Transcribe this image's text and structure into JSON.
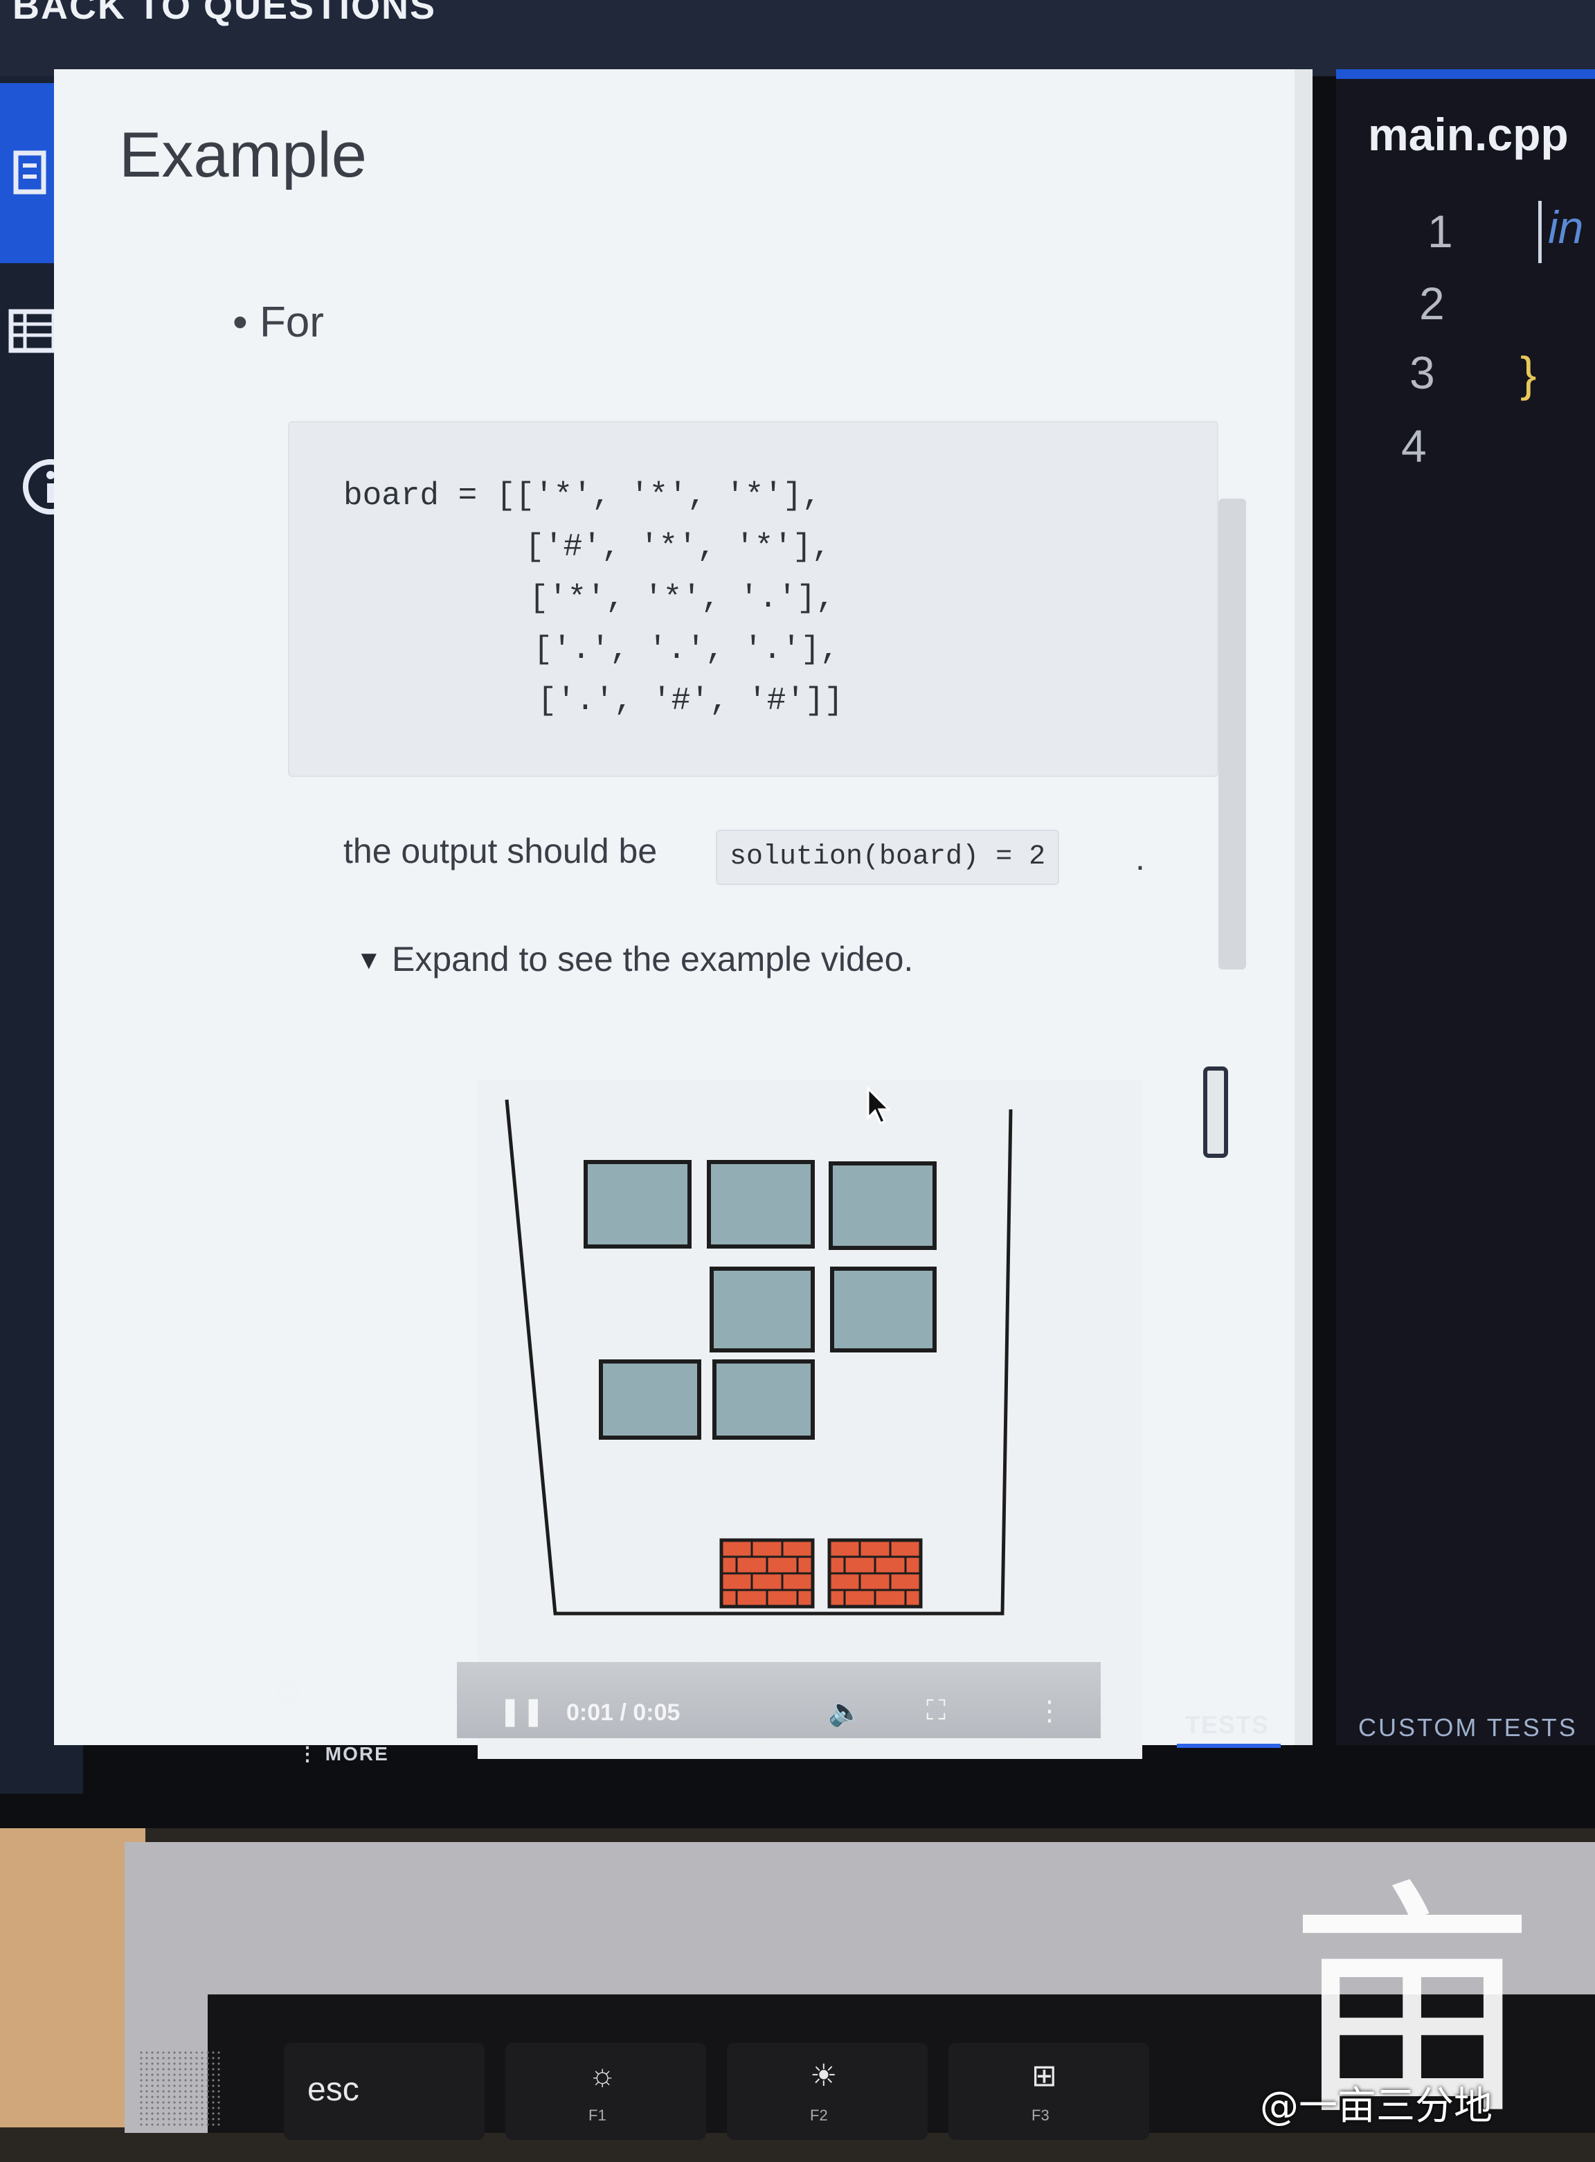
{
  "header": {
    "back_link": "BACK TO QUESTIONS"
  },
  "sidebar": {
    "icons": [
      "document-icon",
      "table-icon",
      "info-icon"
    ],
    "active_index": 0,
    "bottom": {
      "settings_icon": "gear-icon",
      "more_label": "MORE"
    }
  },
  "description": {
    "title": "Example",
    "bullet": "For",
    "code_lines": [
      "board = [['*', '*', '*'],",
      "         ['#', '*', '*'],",
      "         ['*', '*', '.'],",
      "         ['.', '.', '.'],",
      "         ['.', '#', '#']]"
    ],
    "output_prefix": "the output should be",
    "output_code": "solution(board) = 2",
    "output_suffix": ".",
    "expand_label": "Expand to see the example video."
  },
  "video": {
    "time": "0:01 / 0:05",
    "state": "playing",
    "controls": [
      "pause-icon",
      "volume-icon",
      "fullscreen-icon",
      "more-vert-icon"
    ],
    "colors": {
      "box": "#93adb5",
      "brick": "#e25b3b",
      "outline": "#1d1d1d"
    }
  },
  "editor": {
    "file_tab": "main.cpp",
    "line_numbers": [
      "1",
      "2",
      "3",
      "4"
    ],
    "line1_code": "in",
    "line3_code": "}",
    "accent": "#1f56d6"
  },
  "bottom_tabs": {
    "tests": "TESTS",
    "custom_tests": "CUSTOM TESTS"
  },
  "keyboard": {
    "keys": [
      {
        "label": "esc"
      },
      {
        "symbol": "☼",
        "fn": "F1"
      },
      {
        "symbol": "☀",
        "fn": "F2"
      },
      {
        "symbol": "⊞",
        "fn": "F3"
      }
    ]
  },
  "watermark": {
    "glyph": "亩",
    "text": "@一亩三分地"
  }
}
